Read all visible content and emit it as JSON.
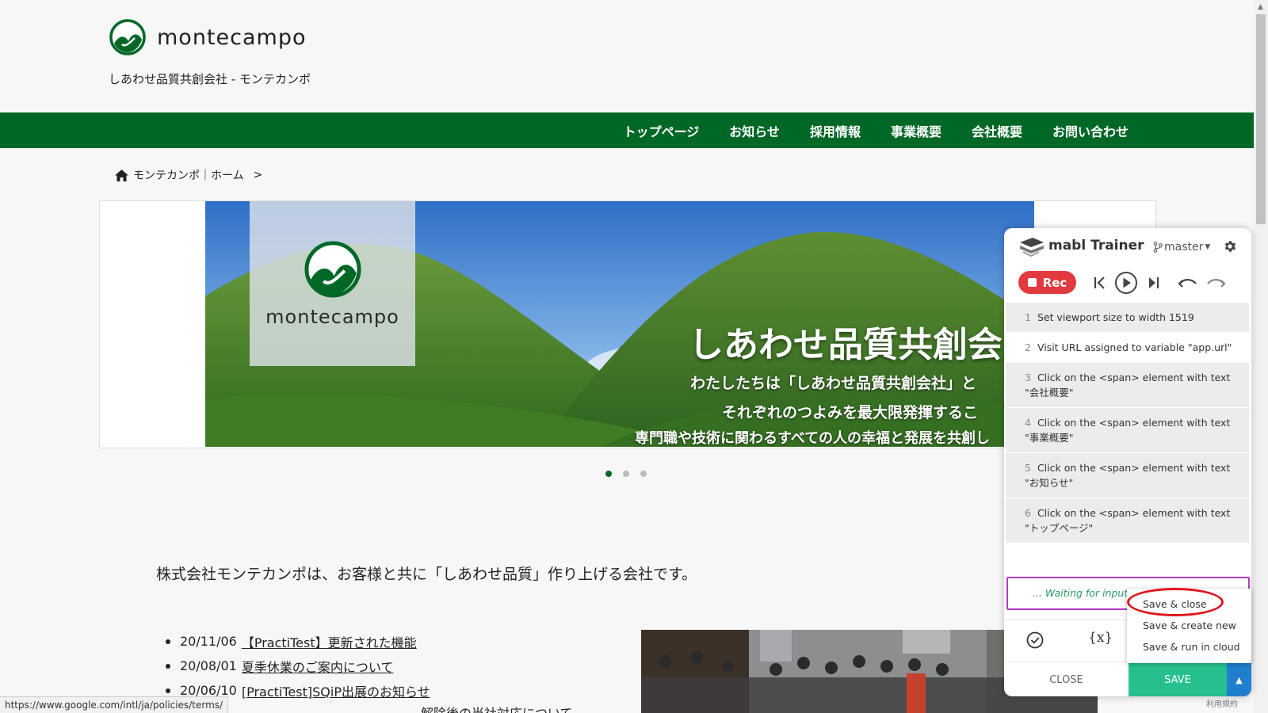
{
  "site": {
    "logo_text": "montecampo",
    "tagline": "しあわせ品質共創会社 - モンテカンポ",
    "colors": {
      "brand_green": "#006827",
      "page_bg": "#f7f7f7"
    }
  },
  "nav": {
    "items": [
      {
        "label": "トップページ"
      },
      {
        "label": "お知らせ"
      },
      {
        "label": "採用情報"
      },
      {
        "label": "事業概要"
      },
      {
        "label": "会社概要"
      },
      {
        "label": "お問い合わせ"
      }
    ]
  },
  "breadcrumb": {
    "home": "モンテカンポ｜ホーム",
    "separator": ">"
  },
  "slider": {
    "logo_text": "montecampo",
    "title": "しあわせ品質共創会",
    "line1": "わたしたちは「しあわせ品質共創会社」と",
    "line2": "それぞれのつよみを最大限発揮するこ",
    "line3": "専門職や技術に関わるすべての人の幸福と発展を共創し",
    "active_dot": 1,
    "dot_count": 3
  },
  "content": {
    "intro": "株式会社モンテカンポは、お客様と共に「しあわせ品質」作り上げる会社です。",
    "news": [
      {
        "date": "20/11/06",
        "title": "【PractiTest】更新された機能"
      },
      {
        "date": "20/08/01",
        "title": "夏季休業のご案内について"
      },
      {
        "date": "20/06/10",
        "title": "[PractiTest]SQiP出展のお知らせ"
      }
    ],
    "truncated_line": "解除後の当社対応について"
  },
  "status_bar": {
    "url": "https://www.google.com/intl/ja/policies/terms/"
  },
  "trainer": {
    "title": "mabl Trainer",
    "branch": "master",
    "rec_label": "Rec",
    "steps": [
      {
        "num": "1",
        "text": "Set viewport size to width 1519"
      },
      {
        "num": "2",
        "text": "Visit URL assigned to variable \"app.url\""
      },
      {
        "num": "3",
        "text": "Click on the <span> element with text \"会社概要\""
      },
      {
        "num": "4",
        "text": "Click on the <span> element with text \"事業概要\""
      },
      {
        "num": "5",
        "text": "Click on the <span> element with text \"お知らせ\""
      },
      {
        "num": "6",
        "text": "Click on the <span> element with text \"トップページ\""
      }
    ],
    "waiting": "... Waiting for input",
    "variable_label": "{x}",
    "close_label": "CLOSE",
    "save_label": "SAVE",
    "save_menu": [
      {
        "label": "Save & close"
      },
      {
        "label": "Save & create new"
      },
      {
        "label": "Save & run in cloud"
      }
    ],
    "colors": {
      "rec": "#e03a3e",
      "save": "#26c08e",
      "menu_toggle": "#1f7fce",
      "waiting_border": "#b23bc4",
      "highlight": "#e0141d"
    }
  },
  "footer_tiny": "利用規約"
}
